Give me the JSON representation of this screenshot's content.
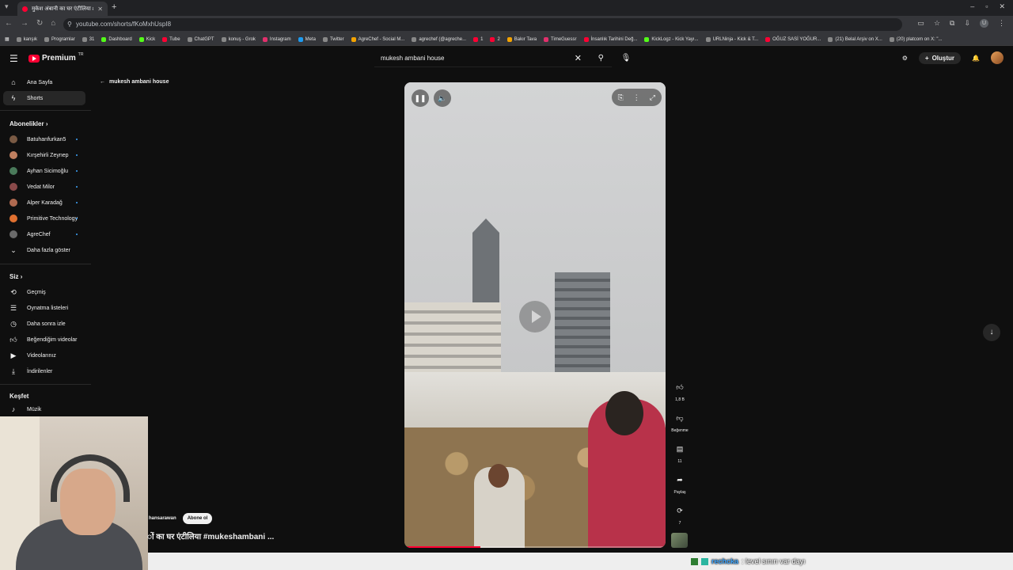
{
  "browser": {
    "tab_title": "मुकेश अंबानी का घर एंटीलिया #m...",
    "url": "youtube.com/shorts/fKoMxhUspI8",
    "profile_initial": "U",
    "bookmarks": [
      {
        "label": "kanşık",
        "icon": "folder-icon",
        "color": "#888888"
      },
      {
        "label": "Programlar",
        "icon": "folder-icon",
        "color": "#888888"
      },
      {
        "label": "31",
        "icon": "folder-icon",
        "color": "#888888"
      },
      {
        "label": "Dashboard",
        "icon": "kick-icon",
        "color": "#53fc18"
      },
      {
        "label": "Kick",
        "icon": "kick-icon",
        "color": "#53fc18"
      },
      {
        "label": "Tube",
        "icon": "youtube-icon",
        "color": "#ff0033"
      },
      {
        "label": "ChatGPT",
        "icon": "chatgpt-icon",
        "color": "#888888"
      },
      {
        "label": "konuş - Grok",
        "icon": "grok-icon",
        "color": "#888888"
      },
      {
        "label": "Instagram",
        "icon": "instagram-icon",
        "color": "#e1306c"
      },
      {
        "label": "Meta",
        "icon": "meta-icon",
        "color": "#1d9bf0"
      },
      {
        "label": "Twitter",
        "icon": "x-icon",
        "color": "#888888"
      },
      {
        "label": "AgreChef - Social M...",
        "icon": "agrechef-icon",
        "color": "#f4a300"
      },
      {
        "label": "agrechef (@agreche...",
        "icon": "tiktok-icon",
        "color": "#888888"
      },
      {
        "label": "1",
        "icon": "youtube-icon",
        "color": "#ff0033"
      },
      {
        "label": "2",
        "icon": "youtube-icon",
        "color": "#ff0033"
      },
      {
        "label": "Bakır Tava",
        "icon": "site-icon",
        "color": "#f4a300"
      },
      {
        "label": "TimeGuessr",
        "icon": "site-icon",
        "color": "#e1306c"
      },
      {
        "label": "İnsanlık Tarihini Değ...",
        "icon": "youtube-icon",
        "color": "#ff0033"
      },
      {
        "label": "KickLogz - Kick Yayı...",
        "icon": "kick-icon",
        "color": "#53fc18"
      },
      {
        "label": "URLNinja - Kick & T...",
        "icon": "site-icon",
        "color": "#888888"
      },
      {
        "label": "OĞUZ SASİ YOĞUR...",
        "icon": "youtube-icon",
        "color": "#ff0033"
      },
      {
        "label": "(21) Belal Arşiv on X...",
        "icon": "x-icon",
        "color": "#888888"
      },
      {
        "label": "(20) platcom on X: \"...",
        "icon": "x-icon",
        "color": "#888888"
      }
    ]
  },
  "header": {
    "logo_text": "Premium",
    "logo_tm": "TR",
    "search_value": "mukesh ambani house",
    "create_label": "Oluştur"
  },
  "sidebar": {
    "home": "Ana Sayfa",
    "shorts": "Shorts",
    "subs_heading": "Abonelikler",
    "subscriptions": [
      "Batuhanfurkan5",
      "Kırşehirli Zeynep",
      "Ayhan Sicimoğlu",
      "Vedat Milor",
      "Alper Karadağ",
      "Primitive Technology",
      "AgreChef"
    ],
    "show_more": "Daha fazla göster",
    "you_heading": "Siz",
    "you_items": [
      {
        "label": "Geçmiş",
        "icon": "history-icon"
      },
      {
        "label": "Oynatma listeleri",
        "icon": "playlists-icon"
      },
      {
        "label": "Daha sonra izle",
        "icon": "watch-later-icon"
      },
      {
        "label": "Beğendiğim videolar",
        "icon": "liked-icon"
      },
      {
        "label": "Videolarınız",
        "icon": "your-videos-icon"
      },
      {
        "label": "İndirilenler",
        "icon": "download-icon"
      }
    ],
    "explore_heading": "Keşfet",
    "explore_items": [
      {
        "label": "Müzik",
        "icon": "music-icon"
      }
    ]
  },
  "shorts": {
    "back_title": "mukesh ambani house",
    "channel": "hansarawan",
    "subscribe_label": "Abone ol",
    "title": "ों का घर एंटीलिया #mukeshambani ...",
    "progress": 0.29,
    "likes": "1,8 B",
    "dislike_label": "Beğenme",
    "comments": "11",
    "share_label": "Paylaş",
    "remix": "7"
  },
  "overlay": {
    "chat_user": "rechcka",
    "chat_message": ": level sınırı var dayı"
  },
  "colors": {
    "accent": "#ff0033",
    "bg": "#0f0f0f",
    "link": "#3ea6ff"
  }
}
